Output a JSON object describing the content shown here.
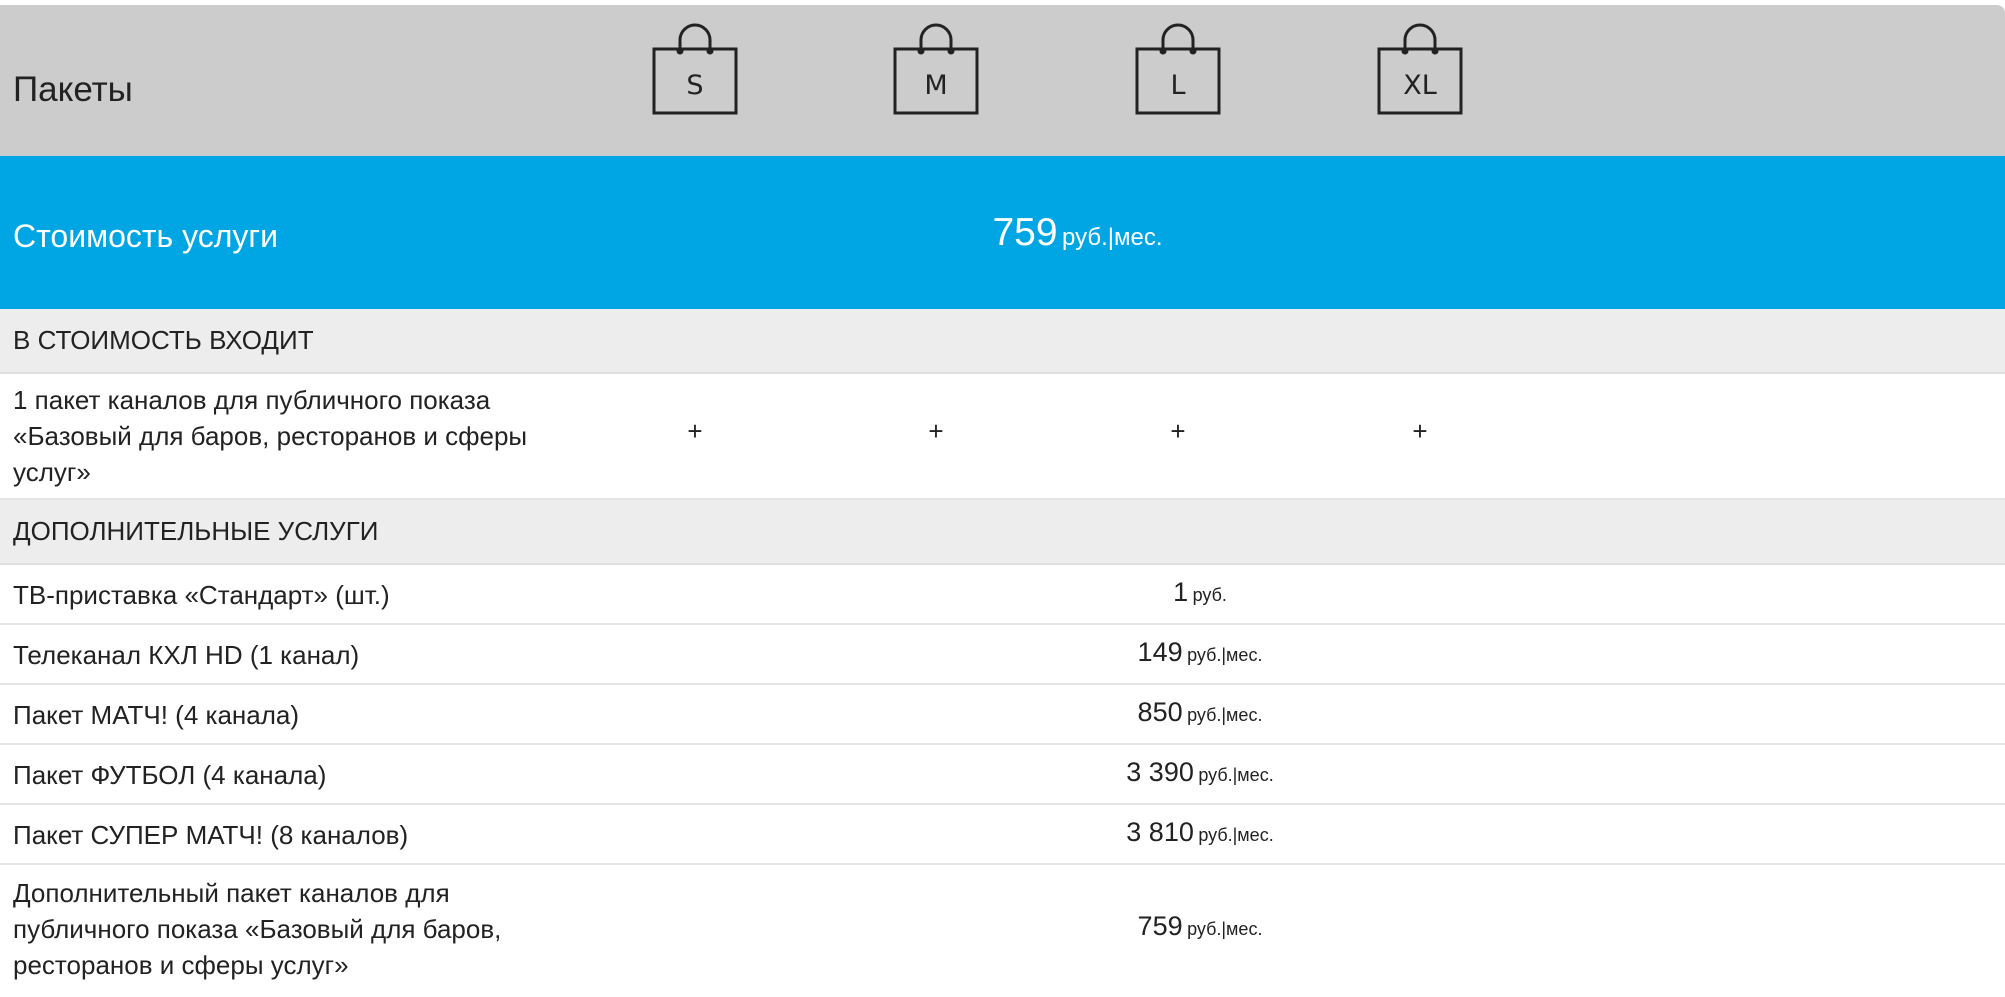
{
  "header": {
    "title": "Пакеты",
    "packages": [
      "S",
      "M",
      "L",
      "XL"
    ],
    "package_icon": "shopping-bag-icon"
  },
  "price": {
    "label": "Стоимость услуги",
    "value": "759",
    "unit": "руб.|мес."
  },
  "included": {
    "heading": "В СТОИМОСТЬ ВХОДИТ",
    "items": [
      {
        "lines": [
          "1 пакет каналов для публичного показа",
          "«Базовый для баров, ресторанов и сферы",
          "услуг»"
        ],
        "marks": [
          "+",
          "+",
          "+",
          "+"
        ]
      }
    ]
  },
  "extras": {
    "heading": "ДОПОЛНИТЕЛЬНЫЕ УСЛУГИ",
    "items": [
      {
        "lines": [
          "ТВ-приставка «Стандарт» (шт.)"
        ],
        "value": "1",
        "unit": "руб."
      },
      {
        "lines": [
          "Телеканал КХЛ HD (1 канал)"
        ],
        "value": "149",
        "unit": "руб.|мес."
      },
      {
        "lines": [
          "Пакет МАТЧ! (4 канала)"
        ],
        "value": "850",
        "unit": "руб.|мес."
      },
      {
        "lines": [
          "Пакет ФУТБОЛ (4 канала)"
        ],
        "value": "3 390",
        "unit": "руб.|мес."
      },
      {
        "lines": [
          "Пакет СУПЕР МАТЧ! (8 каналов)"
        ],
        "value": "3 810",
        "unit": "руб.|мес."
      },
      {
        "lines": [
          "Дополнительный пакет каналов для",
          "публичного показа «Базовый для баров,",
          "ресторанов и сферы услуг»"
        ],
        "value": "759",
        "unit": "руб.|мес."
      }
    ]
  },
  "colors": {
    "header_bg": "#cccccc",
    "price_bg": "#00a6e4",
    "section_bg": "#ededed"
  }
}
